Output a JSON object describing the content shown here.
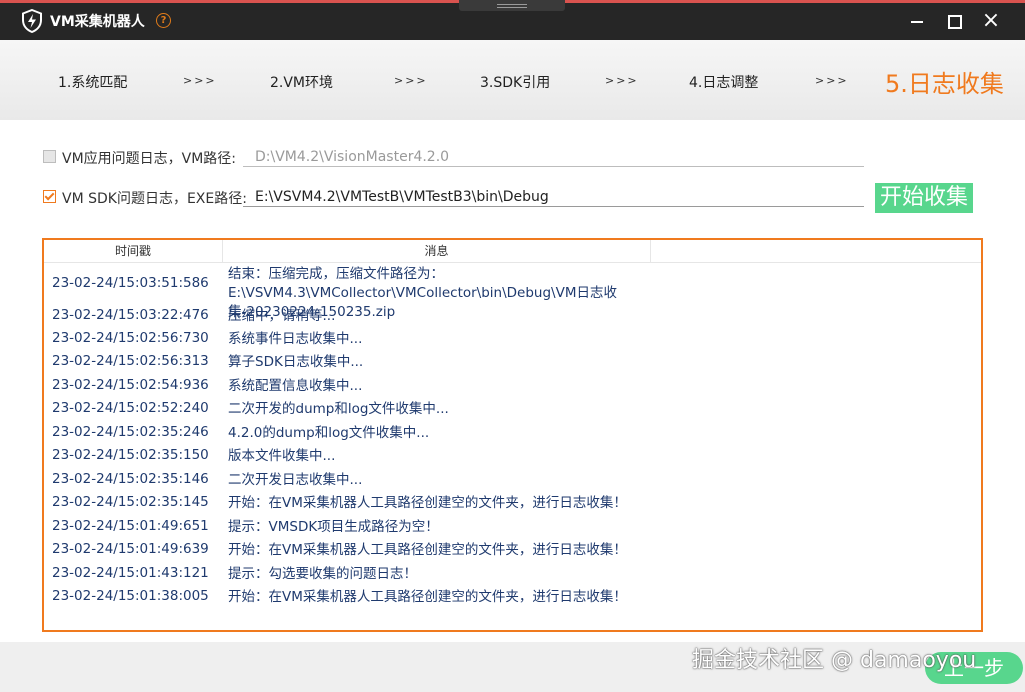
{
  "app": {
    "title": "VM采集机器人",
    "help": "?",
    "window_controls": {
      "minimize": "minimize-icon",
      "maximize": "maximize-icon",
      "close": "×"
    }
  },
  "steps": [
    {
      "label": "1.系统匹配"
    },
    {
      "label": "2.VM环境"
    },
    {
      "label": "3.SDK引用"
    },
    {
      "label": "4.日志调整"
    },
    {
      "label": "5.日志收集",
      "active": true
    }
  ],
  "step_separator": ">>>",
  "options": {
    "vm_log": {
      "checked": false,
      "label": "VM应用问题日志，VM路径:",
      "value": "D:\\VM4.2\\VisionMaster4.2.0"
    },
    "sdk_log": {
      "checked": true,
      "label": "VM SDK问题日志，EXE路径:",
      "value": "E:\\VSVM4.2\\VMTestB\\VMTestB3\\bin\\Debug"
    }
  },
  "start_button": "开始收集",
  "log": {
    "columns": {
      "timestamp": "时间戳",
      "message": "消息"
    },
    "rows": [
      {
        "ts": "23-02-24/15:03:51:586",
        "msg": "结束：压缩完成，压缩文件路径为：E:\\VSVM4.3\\VMCollector\\VMCollector\\bin\\Debug\\VM日志收集-20230224-150235.zip"
      },
      {
        "ts": "23-02-24/15:03:22:476",
        "msg": "压缩中，请稍等..."
      },
      {
        "ts": "23-02-24/15:02:56:730",
        "msg": "系统事件日志收集中..."
      },
      {
        "ts": "23-02-24/15:02:56:313",
        "msg": "算子SDK日志收集中..."
      },
      {
        "ts": "23-02-24/15:02:54:936",
        "msg": "系统配置信息收集中..."
      },
      {
        "ts": "23-02-24/15:02:52:240",
        "msg": "二次开发的dump和log文件收集中..."
      },
      {
        "ts": "23-02-24/15:02:35:246",
        "msg": "4.2.0的dump和log文件收集中..."
      },
      {
        "ts": "23-02-24/15:02:35:150",
        "msg": "版本文件收集中..."
      },
      {
        "ts": "23-02-24/15:02:35:146",
        "msg": "二次开发日志收集中..."
      },
      {
        "ts": "23-02-24/15:02:35:145",
        "msg": "开始：在VM采集机器人工具路径创建空的文件夹，进行日志收集！"
      },
      {
        "ts": "23-02-24/15:01:49:651",
        "msg": "提示：VMSDK项目生成路径为空！"
      },
      {
        "ts": "23-02-24/15:01:49:639",
        "msg": "开始：在VM采集机器人工具路径创建空的文件夹，进行日志收集！"
      },
      {
        "ts": "23-02-24/15:01:43:121",
        "msg": "提示：勾选要收集的问题日志！"
      },
      {
        "ts": "23-02-24/15:01:38:005",
        "msg": "开始：在VM采集机器人工具路径创建空的文件夹，进行日志收集！"
      }
    ]
  },
  "prev_button": "上一步",
  "watermark": "掘金技术社区 @ damaoyou",
  "colors": {
    "accent": "#f07a1e",
    "button_green": "#58d68d",
    "titlebar": "#262626",
    "log_text": "#1f3a6e"
  }
}
